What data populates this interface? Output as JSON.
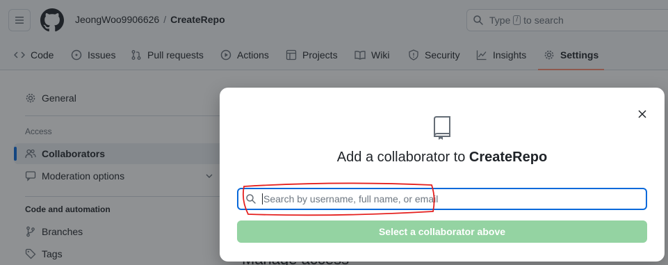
{
  "header": {
    "owner": "JeongWoo9906626",
    "separator": "/",
    "repo": "CreateRepo",
    "search": {
      "prefix": "Type",
      "key": "/",
      "suffix": "to search"
    }
  },
  "tabs": [
    {
      "label": "Code",
      "icon": "code-icon"
    },
    {
      "label": "Issues",
      "icon": "issue-icon"
    },
    {
      "label": "Pull requests",
      "icon": "pull-request-icon"
    },
    {
      "label": "Actions",
      "icon": "play-icon"
    },
    {
      "label": "Projects",
      "icon": "table-icon"
    },
    {
      "label": "Wiki",
      "icon": "book-icon"
    },
    {
      "label": "Security",
      "icon": "shield-icon"
    },
    {
      "label": "Insights",
      "icon": "graph-icon"
    },
    {
      "label": "Settings",
      "icon": "gear-icon",
      "active": true
    }
  ],
  "sidebar": {
    "general": "General",
    "access_heading": "Access",
    "collaborators": "Collaborators",
    "moderation": "Moderation options",
    "code_heading": "Code and automation",
    "branches": "Branches",
    "tags": "Tags"
  },
  "background": {
    "partial_heading": "Manage access"
  },
  "dialog": {
    "title_prefix": "Add a collaborator to",
    "title_repo": "CreateRepo",
    "input_placeholder": "Search by username, full name, or email",
    "button_label": "Select a collaborator above"
  },
  "colors": {
    "accent": "#0969da",
    "active_tab_underline": "#fd8c73",
    "disabled_button": "#94d3a2",
    "annotation": "#e5201e"
  }
}
